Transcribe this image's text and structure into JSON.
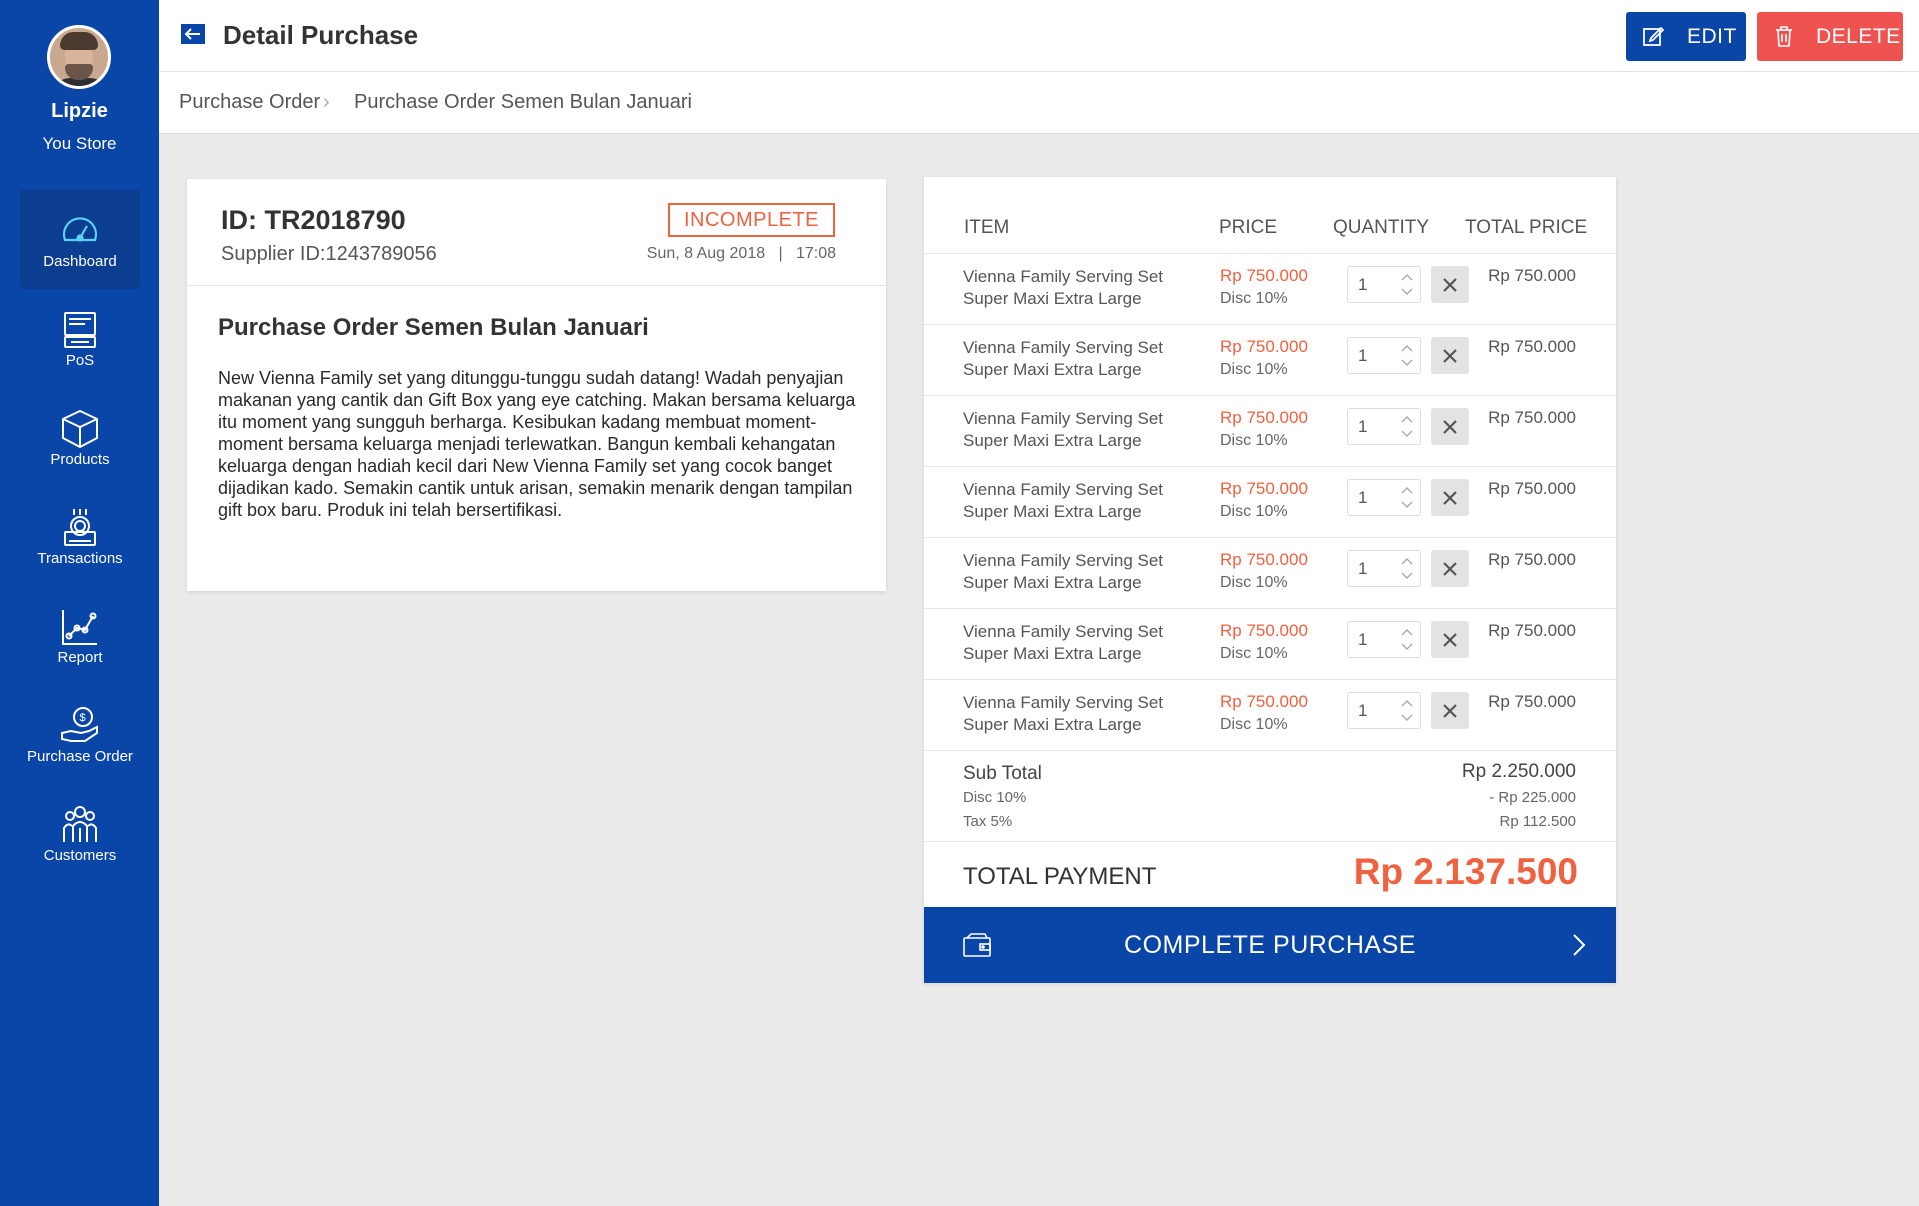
{
  "profile": {
    "name": "Lipzie",
    "store": "You Store"
  },
  "nav": [
    {
      "label": "Dashboard",
      "icon": "dashboard-icon",
      "active": true
    },
    {
      "label": "PoS",
      "icon": "pos-icon"
    },
    {
      "label": "Products",
      "icon": "products-icon"
    },
    {
      "label": "Transactions",
      "icon": "transactions-icon"
    },
    {
      "label": "Report",
      "icon": "report-icon"
    },
    {
      "label": "Purchase Order",
      "icon": "purchase-order-icon"
    },
    {
      "label": "Customers",
      "icon": "customers-icon"
    }
  ],
  "header": {
    "title": "Detail Purchase",
    "edit_label": "EDIT",
    "delete_label": "DELETE"
  },
  "breadcrumb": {
    "parent": "Purchase Order",
    "current": "Purchase Order Semen Bulan Januari"
  },
  "order": {
    "id": "ID: TR2018790",
    "supplier": "Supplier ID:1243789056",
    "status": "INCOMPLETE",
    "date": "Sun, 8 Aug 2018",
    "time": "17:08",
    "title": "Purchase Order Semen Bulan Januari",
    "description": "New Vienna Family set yang ditunggu-tunggu sudah datang! Wadah penyajian makanan yang cantik dan Gift Box yang eye catching. Makan bersama keluarga itu moment yang sungguh berharga. Kesibukan kadang membuat moment-moment bersama keluarga menjadi terlewatkan. Bangun kembali kehangatan keluarga dengan hadiah kecil dari New Vienna Family set yang cocok banget dijadikan kado. Semakin cantik untuk arisan, semakin menarik dengan tampilan gift box baru. Produk ini telah bersertifikasi."
  },
  "table": {
    "headers": {
      "item": "ITEM",
      "price": "PRICE",
      "quantity": "QUANTITY",
      "total": "TOTAL PRICE"
    },
    "rows": [
      {
        "name": "Vienna Family Serving Set",
        "variant": "Super Maxi Extra Large",
        "price": "Rp 750.000",
        "disc": "Disc 10%",
        "qty": "1",
        "total": "Rp 750.000"
      },
      {
        "name": "Vienna Family Serving Set",
        "variant": "Super Maxi Extra Large",
        "price": "Rp 750.000",
        "disc": "Disc 10%",
        "qty": "1",
        "total": "Rp 750.000"
      },
      {
        "name": "Vienna Family Serving Set",
        "variant": "Super Maxi Extra Large",
        "price": "Rp 750.000",
        "disc": "Disc 10%",
        "qty": "1",
        "total": "Rp 750.000"
      },
      {
        "name": "Vienna Family Serving Set",
        "variant": "Super Maxi Extra Large",
        "price": "Rp 750.000",
        "disc": "Disc 10%",
        "qty": "1",
        "total": "Rp 750.000"
      },
      {
        "name": "Vienna Family Serving Set",
        "variant": "Super Maxi Extra Large",
        "price": "Rp 750.000",
        "disc": "Disc 10%",
        "qty": "1",
        "total": "Rp 750.000"
      },
      {
        "name": "Vienna Family Serving Set",
        "variant": "Super Maxi Extra Large",
        "price": "Rp 750.000",
        "disc": "Disc 10%",
        "qty": "1",
        "total": "Rp 750.000"
      },
      {
        "name": "Vienna Family Serving Set",
        "variant": "Super Maxi Extra Large",
        "price": "Rp 750.000",
        "disc": "Disc 10%",
        "qty": "1",
        "total": "Rp 750.000"
      }
    ]
  },
  "summary": {
    "subtotal_label": "Sub Total",
    "subtotal_value": "Rp 2.250.000",
    "disc_label": "Disc 10%",
    "disc_value": "- Rp 225.000",
    "tax_label": "Tax 5%",
    "tax_value": "Rp 112.500",
    "total_label": "TOTAL PAYMENT",
    "total_value": "Rp 2.137.500"
  },
  "cta": {
    "label": "COMPLETE PURCHASE"
  },
  "colors": {
    "primary": "#0a45a8",
    "danger": "#ef5350",
    "accent": "#f0613f",
    "background": "#ebebeb"
  }
}
